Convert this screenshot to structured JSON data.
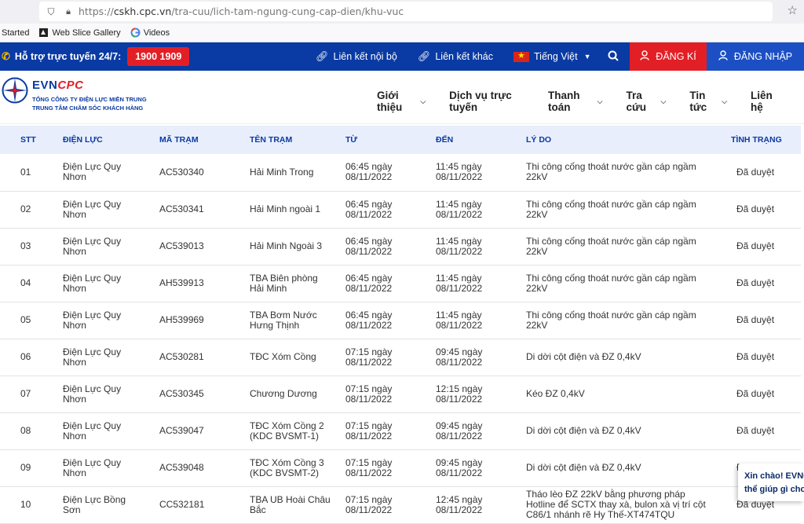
{
  "browser": {
    "url_prefix": "https://",
    "url_host": "cskh.cpc.vn",
    "url_path": "/tra-cuu/lich-tam-ngung-cung-cap-dien/khu-vuc",
    "bookmarks": [
      "Started",
      "Web Slice Gallery",
      "Videos"
    ]
  },
  "topbar": {
    "support_label": "Hỗ trợ trực tuyến 24/7:",
    "hotline": "1900 1909",
    "link_internal": "Liên kết nội bộ",
    "link_other": "Liên kết khác",
    "language": "Tiếng Việt",
    "register": "ĐĂNG KÍ",
    "login": "ĐĂNG NHẬP"
  },
  "logo": {
    "brand_evn": "EVN",
    "brand_cpc": "CPC",
    "line1": "TỔNG CÔNG TY ĐIỆN LỰC MIỀN TRUNG",
    "line2": "TRUNG TÂM CHĂM SÓC KHÁCH HÀNG"
  },
  "nav": [
    "Giới thiệu",
    "Dịch vụ trực tuyến",
    "Thanh toán",
    "Tra cứu",
    "Tin tức",
    "Liên hệ"
  ],
  "table": {
    "headers": [
      "STT",
      "ĐIỆN LỰC",
      "MÃ TRẠM",
      "TÊN TRẠM",
      "TỪ",
      "ĐẾN",
      "LÝ DO",
      "TÌNH TRẠNG"
    ],
    "rows": [
      {
        "stt": "01",
        "dl1": "Điện Lực Quy",
        "dl2": "Nhơn",
        "ma": "AC530340",
        "ten1": "Hải Minh Trong",
        "ten2": "",
        "tu1": "06:45 ngày",
        "tu2": "08/11/2022",
        "den1": "11:45 ngày",
        "den2": "08/11/2022",
        "ly1": "Thi công cống thoát nước gần cáp ngầm",
        "ly2": "22kV",
        "ly3": "",
        "tt": "Đã duyệt"
      },
      {
        "stt": "02",
        "dl1": "Điện Lực Quy",
        "dl2": "Nhơn",
        "ma": "AC530341",
        "ten1": "Hải Minh ngoài 1",
        "ten2": "",
        "tu1": "06:45 ngày",
        "tu2": "08/11/2022",
        "den1": "11:45 ngày",
        "den2": "08/11/2022",
        "ly1": "Thi công cống thoát nước gần cáp ngầm",
        "ly2": "22kV",
        "ly3": "",
        "tt": "Đã duyệt"
      },
      {
        "stt": "03",
        "dl1": "Điện Lực Quy",
        "dl2": "Nhơn",
        "ma": "AC539013",
        "ten1": "Hải Minh Ngoài 3",
        "ten2": "",
        "tu1": "06:45 ngày",
        "tu2": "08/11/2022",
        "den1": "11:45 ngày",
        "den2": "08/11/2022",
        "ly1": "Thi công cống thoát nước gần cáp ngầm",
        "ly2": "22kV",
        "ly3": "",
        "tt": "Đã duyệt"
      },
      {
        "stt": "04",
        "dl1": "Điện Lực Quy",
        "dl2": "Nhơn",
        "ma": "AH539913",
        "ten1": "TBA Biên phòng",
        "ten2": "Hải Minh",
        "tu1": "06:45 ngày",
        "tu2": "08/11/2022",
        "den1": "11:45 ngày",
        "den2": "08/11/2022",
        "ly1": "Thi công cống thoát nước gần cáp ngầm",
        "ly2": "22kV",
        "ly3": "",
        "tt": "Đã duyệt"
      },
      {
        "stt": "05",
        "dl1": "Điện Lực Quy",
        "dl2": "Nhơn",
        "ma": "AH539969",
        "ten1": "TBA Bơm Nước",
        "ten2": "Hưng Thịnh",
        "tu1": "06:45 ngày",
        "tu2": "08/11/2022",
        "den1": "11:45 ngày",
        "den2": "08/11/2022",
        "ly1": "Thi công cống thoát nước gần cáp ngầm",
        "ly2": "22kV",
        "ly3": "",
        "tt": "Đã duyệt"
      },
      {
        "stt": "06",
        "dl1": "Điện Lực Quy",
        "dl2": "Nhơn",
        "ma": "AC530281",
        "ten1": "TĐC Xóm Cồng",
        "ten2": "",
        "tu1": "07:15 ngày",
        "tu2": "08/11/2022",
        "den1": "09:45 ngày",
        "den2": "08/11/2022",
        "ly1": "Di dời cột điện và ĐZ 0,4kV",
        "ly2": "",
        "ly3": "",
        "tt": "Đã duyệt"
      },
      {
        "stt": "07",
        "dl1": "Điện Lực Quy",
        "dl2": "Nhơn",
        "ma": "AC530345",
        "ten1": "Chương Dương",
        "ten2": "",
        "tu1": "07:15 ngày",
        "tu2": "08/11/2022",
        "den1": "12:15 ngày",
        "den2": "08/11/2022",
        "ly1": "Kéo ĐZ 0,4kV",
        "ly2": "",
        "ly3": "",
        "tt": "Đã duyệt"
      },
      {
        "stt": "08",
        "dl1": "Điện Lực Quy",
        "dl2": "Nhơn",
        "ma": "AC539047",
        "ten1": "TĐC Xóm Cồng 2",
        "ten2": "(KDC BVSMT-1)",
        "tu1": "07:15 ngày",
        "tu2": "08/11/2022",
        "den1": "09:45 ngày",
        "den2": "08/11/2022",
        "ly1": "Di dời cột điện và ĐZ 0,4kV",
        "ly2": "",
        "ly3": "",
        "tt": "Đã duyệt"
      },
      {
        "stt": "09",
        "dl1": "Điện Lực Quy",
        "dl2": "Nhơn",
        "ma": "AC539048",
        "ten1": "TĐC Xóm Cồng 3",
        "ten2": "(KDC BVSMT-2)",
        "tu1": "07:15 ngày",
        "tu2": "08/11/2022",
        "den1": "09:45 ngày",
        "den2": "08/11/2022",
        "ly1": "Di dời cột điện và ĐZ 0,4kV",
        "ly2": "",
        "ly3": "",
        "tt": "Đã duyệt"
      },
      {
        "stt": "10",
        "dl1": "Điện Lực Bồng",
        "dl2": "Sơn",
        "ma": "CC532181",
        "ten1": "TBA UB Hoài Châu",
        "ten2": "Bắc",
        "tu1": "07:15 ngày",
        "tu2": "08/11/2022",
        "den1": "12:45 ngày",
        "den2": "08/11/2022",
        "ly1": "Tháo lèo ĐZ 22kV bằng phương pháp",
        "ly2": "Hotline để SCTX thay xà, bulon xà vị trí cột",
        "ly3": "C86/1 nhánh rẽ Hy Thế-XT474TQU",
        "tt": "Đã duyệt"
      }
    ]
  },
  "chat": {
    "line1": "Xin chào! EVNCPC",
    "line2": "thể giúp gì cho bạn"
  },
  "colors": {
    "primary_blue": "#0a3aa3",
    "red": "#e31f26",
    "header_row": "#e8eefb"
  }
}
